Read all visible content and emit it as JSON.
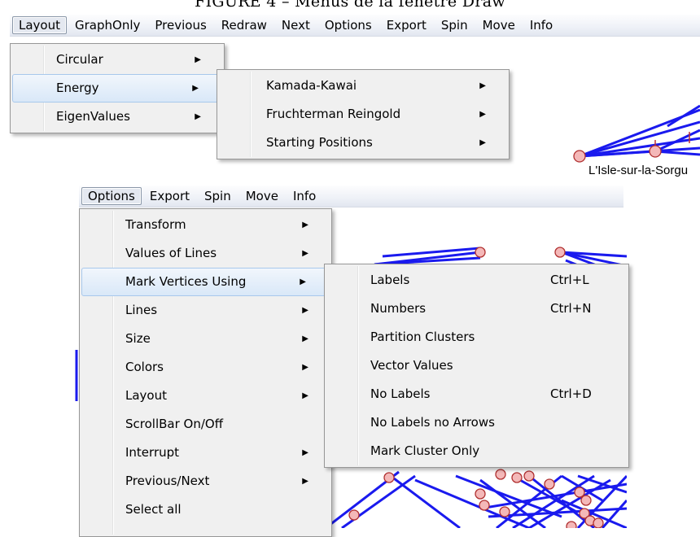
{
  "caption": "FIGURE 4 – Menus de la fenêtre Draw",
  "colors": {
    "edge": "#1a1aee",
    "vertex_fill": "#f4b8b8",
    "vertex_stroke": "#b03030",
    "menu_bg": "#f0f0f0",
    "highlight": "#d9e8f8"
  },
  "top": {
    "menubar": [
      "Layout",
      "GraphOnly",
      "Previous",
      "Redraw",
      "Next",
      "Options",
      "Export",
      "Spin",
      "Move",
      "Info"
    ],
    "layout_menu": [
      {
        "label": "Circular",
        "submenu": true
      },
      {
        "label": "Energy",
        "submenu": true
      },
      {
        "label": "EigenValues",
        "submenu": true
      }
    ],
    "energy_menu": [
      {
        "label": "Kamada-Kawai",
        "submenu": true
      },
      {
        "label": "Fruchterman Reingold",
        "submenu": true
      },
      {
        "label": "Starting Positions",
        "submenu": true
      }
    ],
    "vertex_label": "L'Isle-sur-la-Sorgu"
  },
  "bottom": {
    "menubar": [
      "Options",
      "Export",
      "Spin",
      "Move",
      "Info"
    ],
    "options_menu": [
      {
        "label": "Transform",
        "submenu": true
      },
      {
        "label": "Values of Lines",
        "submenu": true
      },
      {
        "label": "Mark Vertices Using",
        "submenu": true
      },
      {
        "label": "Lines",
        "submenu": true
      },
      {
        "label": "Size",
        "submenu": true
      },
      {
        "label": "Colors",
        "submenu": true
      },
      {
        "label": "Layout",
        "submenu": true
      },
      {
        "label": "ScrollBar On/Off",
        "submenu": false
      },
      {
        "label": "Interrupt",
        "submenu": true
      },
      {
        "label": "Previous/Next",
        "submenu": true
      },
      {
        "label": "Select all",
        "submenu": false
      }
    ],
    "mark_menu": [
      {
        "label": "Labels",
        "shortcut": "Ctrl+L"
      },
      {
        "label": "Numbers",
        "shortcut": "Ctrl+N"
      },
      {
        "label": "Partition Clusters",
        "shortcut": ""
      },
      {
        "label": "Vector Values",
        "shortcut": ""
      },
      {
        "label": "No Labels",
        "shortcut": "Ctrl+D"
      },
      {
        "label": "No Labels no Arrows",
        "shortcut": ""
      },
      {
        "label": "Mark Cluster Only",
        "shortcut": ""
      }
    ]
  }
}
